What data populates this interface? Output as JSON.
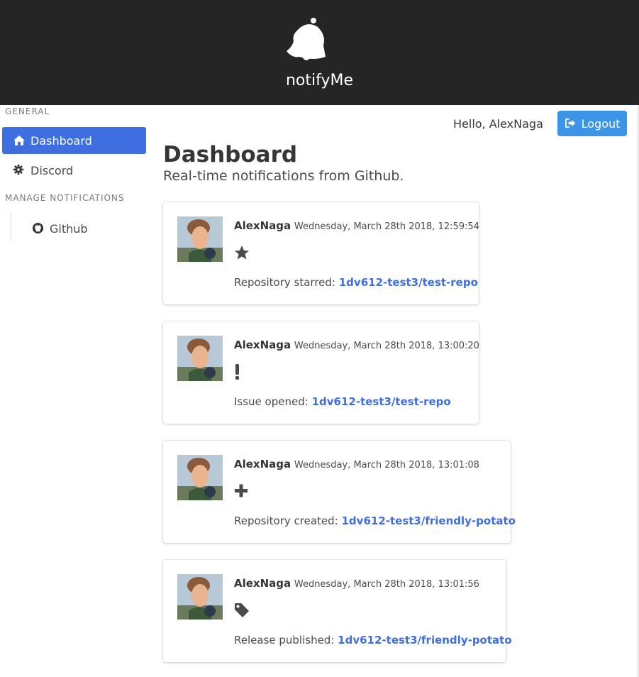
{
  "app": {
    "brand": "notifyMe"
  },
  "sidebar": {
    "general_label": "GENERAL",
    "items": [
      {
        "label": "Dashboard",
        "icon": "home-icon",
        "active": true
      },
      {
        "label": "Discord",
        "icon": "gear-icon"
      }
    ],
    "manage_label": "MANAGE NOTIFICATIONS",
    "sub_items": [
      {
        "label": "Github",
        "icon": "github-icon"
      }
    ]
  },
  "header": {
    "greeting": "Hello, AlexNaga",
    "logout_label": "Logout"
  },
  "main": {
    "title": "Dashboard",
    "subtitle": "Real-time notifications from Github."
  },
  "notifications": [
    {
      "user": "AlexNaga",
      "time": "Wednesday, March 28th 2018, 12:59:54",
      "icon": "star-icon",
      "text": "Repository starred:",
      "link": "1dv612-test3/test-repo"
    },
    {
      "user": "AlexNaga",
      "time": "Wednesday, March 28th 2018, 13:00:20",
      "icon": "exclamation-icon",
      "text": "Issue opened:",
      "link": "1dv612-test3/test-repo"
    },
    {
      "user": "AlexNaga",
      "time": "Wednesday, March 28th 2018, 13:01:08",
      "icon": "plus-icon",
      "text": "Repository created:",
      "link": "1dv612-test3/friendly-potato"
    },
    {
      "user": "AlexNaga",
      "time": "Wednesday, March 28th 2018, 13:01:56",
      "icon": "tag-icon",
      "text": "Release published:",
      "link": "1dv612-test3/friendly-potato"
    }
  ],
  "colors": {
    "hero": "#252525",
    "accent": "#3f6ee0",
    "logout": "#3c94e6"
  }
}
